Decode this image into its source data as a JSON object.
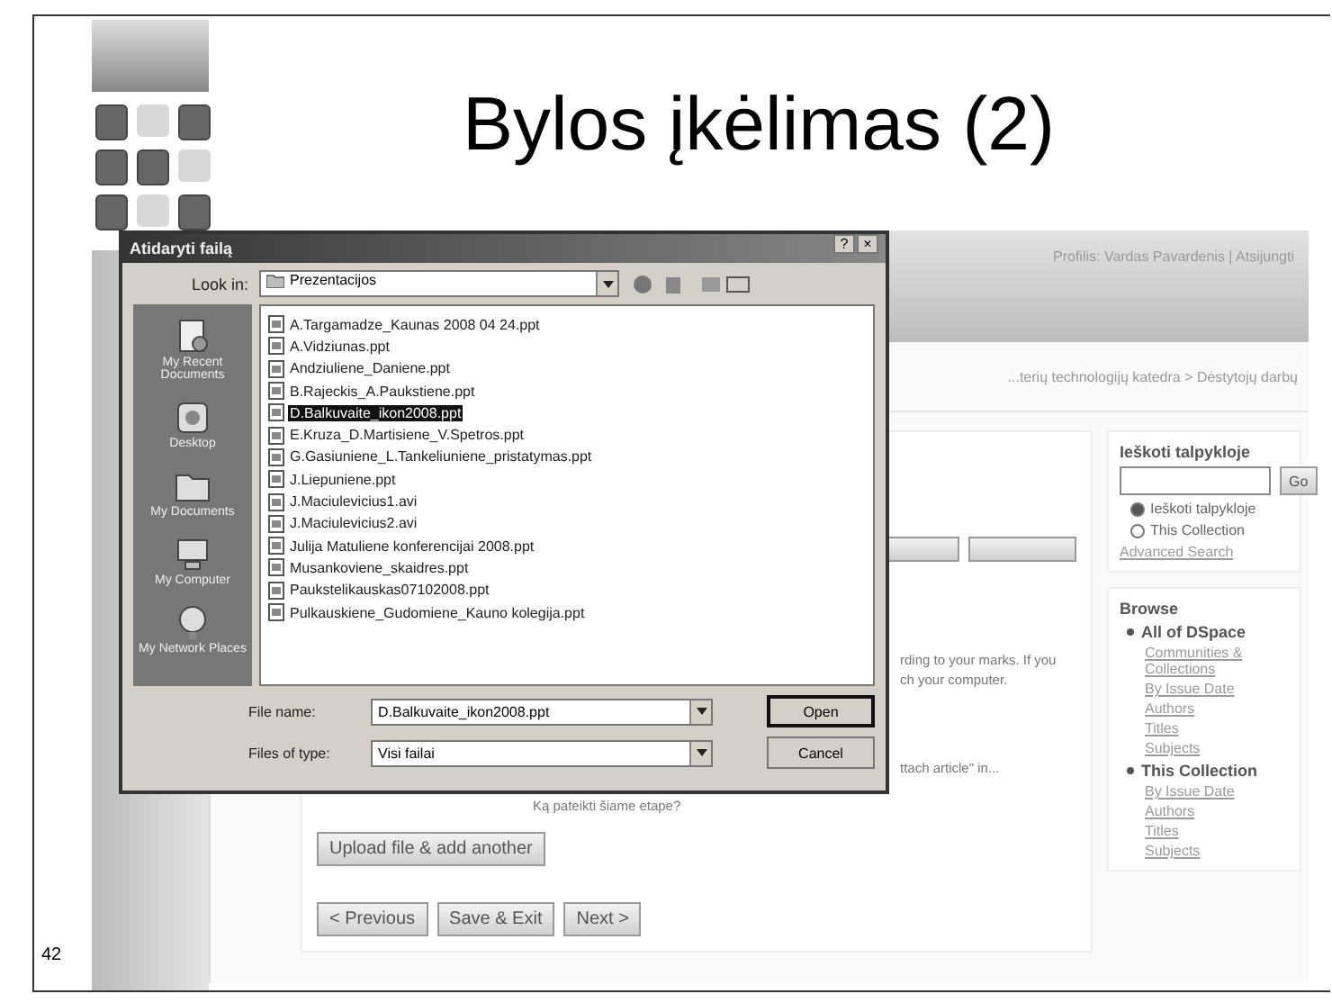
{
  "slide": {
    "title": "Bylos įkėlimas (2)",
    "page_number": "42"
  },
  "web_page": {
    "header_text": "Profilis: Vardas Pavardenis | Atsijungti",
    "breadcrumb": "...terių technologijų katedra > Dėstytojų darbų",
    "notes": [
      {
        "text": "rding to your marks. If you",
        "kind": "right"
      },
      {
        "text": "ch your computer.",
        "kind": "right"
      },
      {
        "text": "ttach article\" in...",
        "kind": "right"
      },
      {
        "text": "Ką pateikti šiame etape?",
        "kind": "center"
      }
    ],
    "upload_button": "Upload file & add another",
    "nav_buttons": [
      "< Previous",
      "Save & Exit",
      "Next >"
    ],
    "search": {
      "title": "Ieškoti talpykloje",
      "go": "Go",
      "scopes": [
        {
          "label": "Ieškoti talpykloje",
          "selected": true
        },
        {
          "label": "This Collection",
          "selected": false
        }
      ],
      "advanced": "Advanced Search"
    },
    "browse": {
      "title": "Browse",
      "groups": [
        {
          "label": "All of DSpace",
          "children": [
            {
              "label": "Communities & Collections"
            },
            {
              "label": "By Issue Date"
            },
            {
              "label": "Authors"
            },
            {
              "label": "Titles"
            },
            {
              "label": "Subjects"
            }
          ]
        },
        {
          "label": "This Collection",
          "children": [
            {
              "label": "By Issue Date"
            },
            {
              "label": "Authors"
            },
            {
              "label": "Titles"
            },
            {
              "label": "Subjects"
            }
          ]
        }
      ]
    }
  },
  "dialog": {
    "title": "Atidaryti failą",
    "help": "?",
    "close": "×",
    "look_in_label": "Look in:",
    "look_in": "Prezentacijos",
    "places": [
      {
        "label": "My Recent Documents",
        "kind": "recent"
      },
      {
        "label": "Desktop",
        "kind": "desktop"
      },
      {
        "label": "My Documents",
        "kind": "documents"
      },
      {
        "label": "My Computer",
        "kind": "computer"
      },
      {
        "label": "My Network Places",
        "kind": "network"
      }
    ],
    "files": [
      {
        "name": "A.Targamadze_Kaunas 2008 04 24.ppt",
        "selected": false
      },
      {
        "name": "A.Vidziunas.ppt",
        "selected": false
      },
      {
        "name": "Andziuliene_Daniene.ppt",
        "selected": false
      },
      {
        "name": "B.Rajeckis_A.Paukstiene.ppt",
        "selected": false
      },
      {
        "name": "D.Balkuvaite_ikon2008.ppt",
        "selected": true
      },
      {
        "name": "E.Kruza_D.Martisiene_V.Spetros.ppt",
        "selected": false
      },
      {
        "name": "G.Gasiuniene_L.Tankeliuniene_pristatymas.ppt",
        "selected": false
      },
      {
        "name": "J.Liepuniene.ppt",
        "selected": false
      },
      {
        "name": "J.Maciulevicius1.avi",
        "selected": false
      },
      {
        "name": "J.Maciulevicius2.avi",
        "selected": false
      },
      {
        "name": "Julija Matuliene konferencijai 2008.ppt",
        "selected": false
      },
      {
        "name": "Musankoviene_skaidres.ppt",
        "selected": false
      },
      {
        "name": "Paukstelikauskas07102008.ppt",
        "selected": false
      },
      {
        "name": "Pulkauskiene_Gudomiene_Kauno kolegija.ppt",
        "selected": false
      }
    ],
    "file_name_label": "File name:",
    "file_name": "D.Balkuvaite_ikon2008.ppt",
    "file_type_label": "Files of type:",
    "file_type": "Visi failai",
    "open": "Open",
    "cancel": "Cancel"
  }
}
